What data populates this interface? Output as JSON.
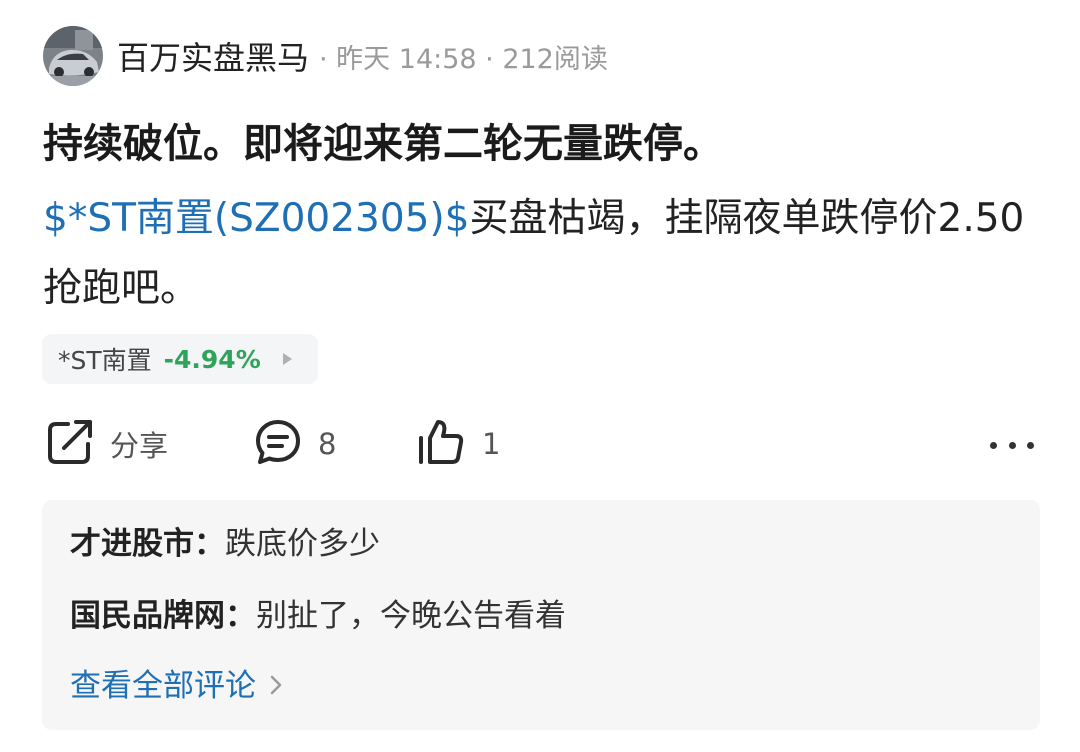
{
  "post": {
    "author": "百万实盘黑马",
    "meta": "· 昨天 14:58 · 212阅读",
    "title": "持续破位。即将迎来第二轮无量跌停。",
    "stock_link": "$*ST南置(SZ002305)$",
    "body_rest": "买盘枯竭，挂隔夜单跌停价2.50抢跑吧。"
  },
  "stock_chip": {
    "name": "*ST南置",
    "change": "-4.94%"
  },
  "actions": {
    "share_label": "分享",
    "comment_count": "8",
    "like_count": "1"
  },
  "comments": [
    {
      "user": "才进股市：",
      "text": "跌底价多少"
    },
    {
      "user": "国民品牌网：",
      "text": "别扯了，今晚公告看着"
    }
  ],
  "view_all_label": "查看全部评论",
  "colors": {
    "link": "#1f6fb5",
    "down": "#2ea35a",
    "chip_bg": "#f4f5f7",
    "comment_bg": "#f6f6f7"
  },
  "icons": {
    "share": "share-icon",
    "comment": "comment-icon",
    "like": "thumbs-up-icon",
    "more": "more-dots-icon"
  }
}
